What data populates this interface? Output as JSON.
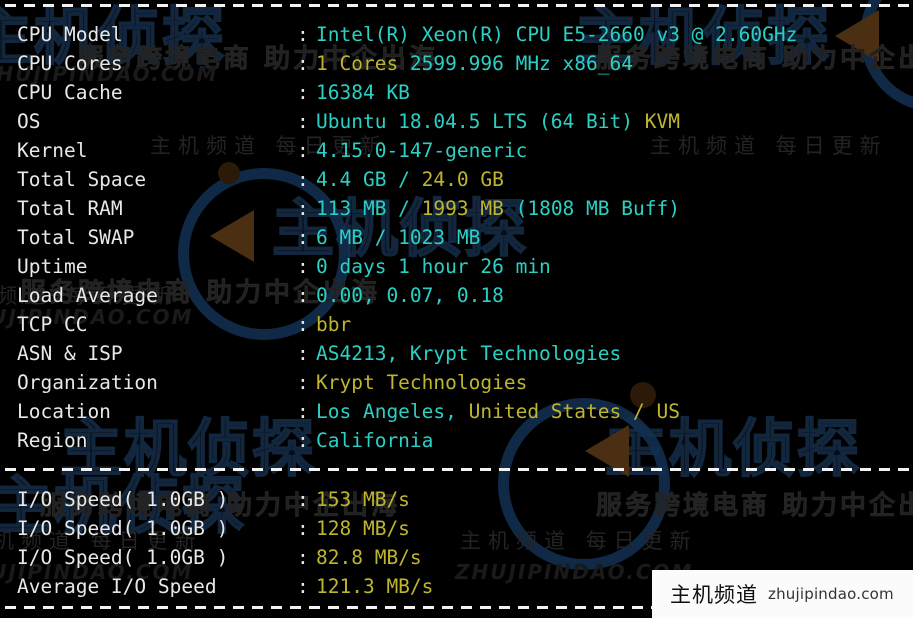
{
  "terminal": {
    "separators_top_text": "----------------------------------------------------------------------",
    "system_info": [
      {
        "label": "CPU Model",
        "segments": [
          {
            "text": "Intel(R) Xeon(R) CPU E5-2660 v3 @ 2.60GHz",
            "color": "cyan"
          }
        ]
      },
      {
        "label": "CPU Cores",
        "segments": [
          {
            "text": "1 Cores ",
            "color": "yellow"
          },
          {
            "text": "2599.996 MHz x86_64",
            "color": "cyan"
          }
        ]
      },
      {
        "label": "CPU Cache",
        "segments": [
          {
            "text": "16384 KB",
            "color": "cyan"
          }
        ]
      },
      {
        "label": "OS",
        "segments": [
          {
            "text": "Ubuntu 18.04.5 LTS (64 Bit) ",
            "color": "cyan"
          },
          {
            "text": "KVM",
            "color": "yellow"
          }
        ]
      },
      {
        "label": "Kernel",
        "segments": [
          {
            "text": "4.15.0-147-generic",
            "color": "cyan"
          }
        ]
      },
      {
        "label": "Total Space",
        "segments": [
          {
            "text": "4.4 GB / ",
            "color": "cyan"
          },
          {
            "text": "24.0 GB",
            "color": "yellow"
          }
        ]
      },
      {
        "label": "Total RAM",
        "segments": [
          {
            "text": "113 MB / ",
            "color": "cyan"
          },
          {
            "text": "1993 MB ",
            "color": "yellow"
          },
          {
            "text": "(1808 MB Buff)",
            "color": "cyan"
          }
        ]
      },
      {
        "label": "Total SWAP",
        "segments": [
          {
            "text": "6 MB / 1023 MB",
            "color": "cyan"
          }
        ]
      },
      {
        "label": "Uptime",
        "segments": [
          {
            "text": "0 days 1 hour 26 min",
            "color": "cyan"
          }
        ]
      },
      {
        "label": "Load Average",
        "segments": [
          {
            "text": "0.00, 0.07, 0.18",
            "color": "cyan"
          }
        ]
      },
      {
        "label": "TCP CC",
        "segments": [
          {
            "text": "bbr",
            "color": "yellow"
          }
        ]
      },
      {
        "label": "ASN & ISP",
        "segments": [
          {
            "text": "AS4213, Krypt Technologies",
            "color": "cyan"
          }
        ]
      },
      {
        "label": "Organization",
        "segments": [
          {
            "text": "Krypt Technologies",
            "color": "yellow"
          }
        ]
      },
      {
        "label": "Location",
        "segments": [
          {
            "text": "Los Angeles, ",
            "color": "cyan"
          },
          {
            "text": "United States / US",
            "color": "yellow"
          }
        ]
      },
      {
        "label": "Region",
        "segments": [
          {
            "text": "California",
            "color": "cyan"
          }
        ]
      }
    ],
    "io_tests": [
      {
        "label": "I/O Speed( 1.0GB )",
        "segments": [
          {
            "text": "153 MB/s",
            "color": "yellow"
          }
        ]
      },
      {
        "label": "I/O Speed( 1.0GB )",
        "segments": [
          {
            "text": "128 MB/s",
            "color": "yellow"
          }
        ]
      },
      {
        "label": "I/O Speed( 1.0GB )",
        "segments": [
          {
            "text": "82.8 MB/s",
            "color": "yellow"
          }
        ]
      },
      {
        "label": "Average I/O Speed",
        "segments": [
          {
            "text": "121.3 MB/s",
            "color": "yellow"
          }
        ]
      }
    ],
    "colon": ":",
    "colors": {
      "background": "#000000",
      "label": "#e8e8e8",
      "value_cyan": "#2bd0c4",
      "value_yellow": "#bfb52e",
      "separator": "#f2f2f2"
    }
  },
  "site_badge": {
    "name_cn": "主机频道",
    "url": "zhujipindao.com"
  },
  "watermarks": {
    "brand_cn_large": "主机侦探",
    "tagline_cn": "服务跨境电商 助力中企出海",
    "channel_cn": "主机频道 每日更新",
    "domain_upper": "ZHUJIPINDAO.COM"
  }
}
